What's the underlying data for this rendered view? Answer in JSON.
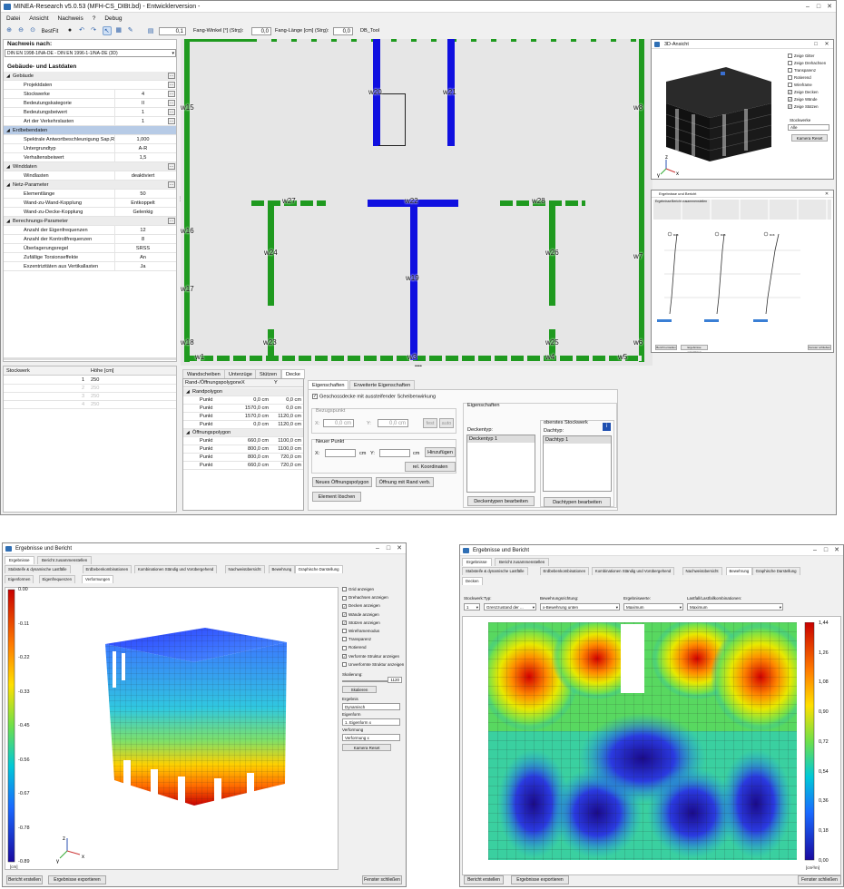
{
  "main": {
    "title": "MINEA-Research v5.0.53 (MFH-CS_DIBt.bd) - Entwicklerversion -",
    "menu": [
      "Datei",
      "Ansicht",
      "Nachweis",
      "?",
      "Debug"
    ],
    "toolbar": {
      "bestfit": "BestFit",
      "value1": "0,1",
      "fang_winkel_label": "Fang-Winkel [°] (Strg):",
      "fang_winkel": "0,0",
      "fang_laenge_label": "Fang-Länge [cm] (Strg):",
      "fang_laenge": "0,0",
      "db_tool": "DB_Tool"
    },
    "nachweis_label": "Nachweis nach:",
    "nachweis_value": "DIN EN 1998-1/NA-DE - DIN EN 1996-1-1/NA-DE (3D)",
    "gebaeude_header": "Gebäude- und Lastdaten",
    "props": [
      {
        "cat": true,
        "k": "Gebäude",
        "v": "",
        "dots": true
      },
      {
        "k": "Projektdaten",
        "v": "",
        "dots": true
      },
      {
        "k": "Stockwerke",
        "v": "4",
        "dots": true
      },
      {
        "k": "Bedeutungskategorie",
        "v": "II",
        "dots": true
      },
      {
        "k": "Bedeutungsbeiwert",
        "v": "1",
        "dots": true
      },
      {
        "k": "Art der Verkehrslasten",
        "v": "1",
        "dots": true
      },
      {
        "cat": true,
        "k": "Erdbebendaten",
        "v": "",
        "sel": true
      },
      {
        "k": "Spektrale Antwortbeschleunigung Sap,R",
        "v": "1,000"
      },
      {
        "k": "Untergrundtyp",
        "v": "A-R"
      },
      {
        "k": "Verhaltensbeiwert",
        "v": "1,5"
      },
      {
        "cat": true,
        "k": "Winddaten",
        "v": "",
        "dots": true
      },
      {
        "k": "Windlasten",
        "v": "deaktiviert"
      },
      {
        "cat": true,
        "k": "Netz-Parameter",
        "v": "",
        "dots": true
      },
      {
        "k": "Elementlänge",
        "v": "50"
      },
      {
        "k": "Wand-zu-Wand-Kopplung",
        "v": "Entkoppelt"
      },
      {
        "k": "Wand-zu-Decke-Kopplung",
        "v": "Gelenkig"
      },
      {
        "cat": true,
        "k": "Berechnungs-Parameter",
        "v": "",
        "dots": true
      },
      {
        "k": "Anzahl der Eigenfrequenzen",
        "v": "12"
      },
      {
        "k": "Anzahl der Kontrollfrequenzen",
        "v": "8"
      },
      {
        "k": "Überlagerungsregel",
        "v": "SRSS"
      },
      {
        "k": "Zufällige Torsionseffekte",
        "v": "An"
      },
      {
        "k": "Exzentrizitäten aus Vertikallasten",
        "v": "Ja"
      }
    ],
    "stockwerk": {
      "col1": "Stockwerk",
      "col2": "Höhe [cm]",
      "rows": [
        [
          "1",
          "250"
        ],
        [
          "2",
          "250"
        ],
        [
          "3",
          "250"
        ],
        [
          "4",
          "250"
        ]
      ]
    },
    "walls": {
      "w20": "w20",
      "w21": "w21",
      "w15": "w15",
      "w8": "w8",
      "w27": "w27",
      "w22": "w22",
      "w28": "w28",
      "w16": "w16",
      "w7": "w7",
      "w24": "w24",
      "w26": "w26",
      "w19": "w19",
      "w17": "w17",
      "w23": "w23",
      "w25": "w25",
      "w18": "w18",
      "w6": "w6",
      "w11": "w1",
      "w3": "w3",
      "w4": "w4",
      "w5": "w5"
    },
    "tabs": [
      "Wandscheiben",
      "Unterzüge",
      "Stützen",
      "Decke"
    ],
    "poly": {
      "h1": "Rand-/Öffnungspolygone",
      "h2": "X",
      "h3": "Y",
      "g1": "Randpolygon",
      "g2": "Öffnungspolygon",
      "pt": "Punkt",
      "r1": [
        [
          "0,0 cm",
          "0,0 cm"
        ],
        [
          "1570,0 cm",
          "0,0 cm"
        ],
        [
          "1570,0 cm",
          "1120,0 cm"
        ],
        [
          "0,0 cm",
          "1120,0 cm"
        ]
      ],
      "r2": [
        [
          "660,0 cm",
          "1100,0 cm"
        ],
        [
          "800,0 cm",
          "1100,0 cm"
        ],
        [
          "800,0 cm",
          "720,0 cm"
        ],
        [
          "660,0 cm",
          "720,0 cm"
        ]
      ]
    },
    "props_tabs": [
      "Eigenschaften",
      "Erweiterte Eigenschaften"
    ],
    "geschossdecke": "Geschossdecke mit aussteifender Scheibenwirkung",
    "bezugspunkt": "Bezugspunkt",
    "x_label": "X:",
    "x_val": "0,0 cm",
    "y_label": "Y:",
    "y_val": "0,0 cm",
    "fest": "fest",
    "auto": "auto",
    "neuer_punkt": "Neuer Punkt",
    "cm": "cm",
    "hinzufuegen": "Hinzufügen",
    "rel": "rel. Koordinaten",
    "btn_neues": "Neues Öffnungspolygon",
    "btn_oeffnung": "Öffnung mit Rand verb.",
    "btn_loeschen": "Element löschen",
    "eigenschaften": "Eigenschaften",
    "deckentyp": "Deckentyp:",
    "deckentyp1": "Deckentyp 1",
    "deckentypen_btn": "Deckentypen bearbeiten",
    "oberstes": "oberstes Stockwerk",
    "dachtyp": "Dachtyp:",
    "dachtyp1": "Dachtyp 1",
    "dachtypen_btn": "Dachtypen bearbeiten",
    "dots": "••••"
  },
  "view3d": {
    "title": "3D-Ansicht",
    "options": [
      "Zeige Gitter",
      "Zeige Drehachsen",
      "Transparenz",
      "Rotierend",
      "Wireframe",
      "Zeige Decken",
      "Zeige Wände",
      "Zeige Stützen"
    ],
    "stockwerke_label": "Stockwerke",
    "stockwerke_val": "Alle",
    "reset": "Kamera Reset",
    "axes": [
      "z",
      "y",
      "x"
    ]
  },
  "mini": {
    "title": "Ergebnisse und Bericht",
    "tabs": [
      "Ergebnisse",
      "Bericht zusammenstellen"
    ],
    "labels": [
      "Drift",
      "Drift",
      "Drift"
    ],
    "buttons": [
      "Bericht erstellen",
      "Ergebnisse exportieren",
      "Fenster schließen"
    ]
  },
  "res_left": {
    "title": "Ergebnisse und Bericht",
    "tabs": [
      "Ergebnisse",
      "Bericht zusammenstellen"
    ],
    "tabs2": [
      "Stabsteife & dynamische Lastfälle",
      "Erdbebenkombinationen",
      "Kombinationen Ständig und Vorübergehend",
      "Nachweisübersicht",
      "Bewehrung",
      "Graphische Darstellung"
    ],
    "tabs3": [
      "Eigenformen",
      "Eigenfrequenzen",
      "Verformungen"
    ],
    "scale": [
      "0.00",
      "-0.11",
      "-0.22",
      "-0.33",
      "-0.45",
      "-0.56",
      "-0.67",
      "-0.78",
      "-0.89"
    ],
    "unit": "[cm]",
    "options": [
      "Grid anzeigen",
      "Drehachsen anzeigen",
      "Decken anzeigen",
      "Wände anzeigen",
      "Stützen anzeigen",
      "Wireframemodus",
      "Transparenz",
      "Rotierend",
      "Verformte Struktur anzeigen",
      "Unverformte Struktur anzeigen"
    ],
    "checked": [
      false,
      false,
      true,
      true,
      true,
      false,
      false,
      false,
      true,
      false
    ],
    "skalierung": "Skalierung:",
    "skal_val": "1120",
    "skalieren": "Skalieren",
    "ergebnis": "Ergebnis",
    "ergebnis_val": "Dynamisch",
    "eigenform": "Eigenform",
    "eigenform_val": "1. Eigenform x",
    "verformung": "Verformung",
    "verformung_val": "Verformung x",
    "reset": "Kamera Reset",
    "buttons": [
      "Bericht erstellen",
      "Ergebnisse exportieren",
      "Fenster schließen"
    ],
    "axes": [
      "z",
      "y",
      "x"
    ]
  },
  "res_right": {
    "title": "Ergebnisse und Bericht",
    "tabs": [
      "Ergebnisse",
      "Bericht zusammenstellen"
    ],
    "tabs2": [
      "Stabsteife & dynamische Lastfälle",
      "Erdbebenkombinationen",
      "Kombinationen Ständig und Vorübergehend",
      "Nachweisübersicht",
      "Bewehrung",
      "Graphische Darstellung"
    ],
    "tabs3": [
      "Decken"
    ],
    "f_labels": [
      "Stockwerk:",
      "Typ:",
      "Bewehrungsrichtung:",
      "Ergebniswerte:",
      "Lastfall/Lastfallkombinationen:"
    ],
    "f_vals": [
      "1",
      "Grenzzustand der ...",
      "x-Bewehrung unten",
      "Maximum",
      "Maximum"
    ],
    "scale": [
      "1,44",
      "1,26",
      "1,08",
      "0,90",
      "0,72",
      "0,54",
      "0,36",
      "0,18",
      "0,00"
    ],
    "unit": "[cm²/m]",
    "buttons": [
      "Bericht erstellen",
      "Ergebnisse exportieren",
      "Fenster schließen"
    ]
  },
  "colors": {
    "wall_green": "#1f9a1f",
    "wall_blue": "#1010e0",
    "title_blue": "#2f6fb5"
  }
}
